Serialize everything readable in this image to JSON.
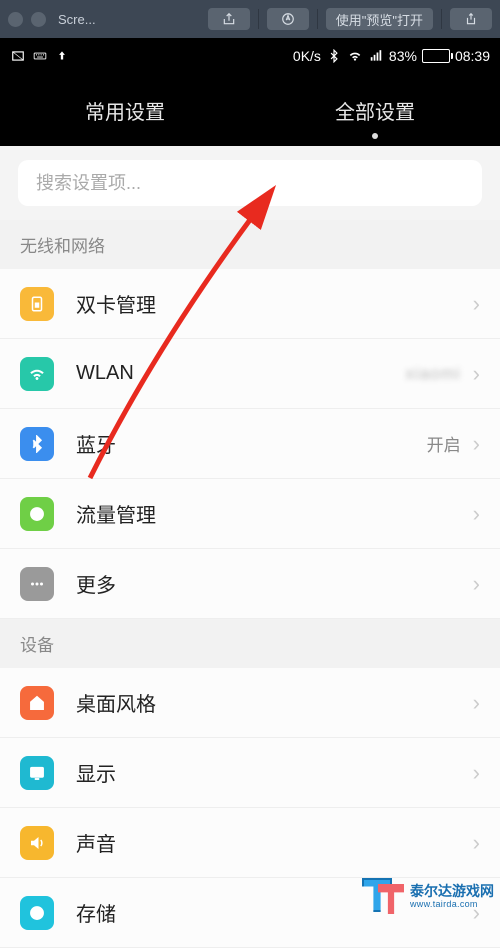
{
  "mac_toolbar": {
    "title": "Scre...",
    "preview_button": "使用\"预览\"打开"
  },
  "status_bar": {
    "speed": "0K/s",
    "battery_percent": "83%",
    "time": "08:39"
  },
  "header": {
    "tabs": [
      {
        "label": "常用设置",
        "active": false
      },
      {
        "label": "全部设置",
        "active": true
      }
    ]
  },
  "search": {
    "placeholder": "搜索设置项..."
  },
  "sections": [
    {
      "title": "无线和网络",
      "items": [
        {
          "icon": "sim-icon",
          "color": "ic-orange",
          "label": "双卡管理",
          "value": ""
        },
        {
          "icon": "wifi-icon",
          "color": "ic-teal",
          "label": "WLAN",
          "value": "xiaomi",
          "blurred": true
        },
        {
          "icon": "bluetooth-icon",
          "color": "ic-blue",
          "label": "蓝牙",
          "value": "开启"
        },
        {
          "icon": "data-icon",
          "color": "ic-green",
          "label": "流量管理",
          "value": ""
        },
        {
          "icon": "more-icon",
          "color": "ic-gray",
          "label": "更多",
          "value": ""
        }
      ]
    },
    {
      "title": "设备",
      "items": [
        {
          "icon": "home-icon",
          "color": "ic-orange2",
          "label": "桌面风格",
          "value": ""
        },
        {
          "icon": "display-icon",
          "color": "ic-cyan",
          "label": "显示",
          "value": ""
        },
        {
          "icon": "sound-icon",
          "color": "ic-yellow",
          "label": "声音",
          "value": ""
        },
        {
          "icon": "storage-icon",
          "color": "ic-cyan2",
          "label": "存储",
          "value": ""
        }
      ]
    }
  ],
  "watermark": {
    "cn": "泰尔达游戏网",
    "en": "www.tairda.com"
  }
}
